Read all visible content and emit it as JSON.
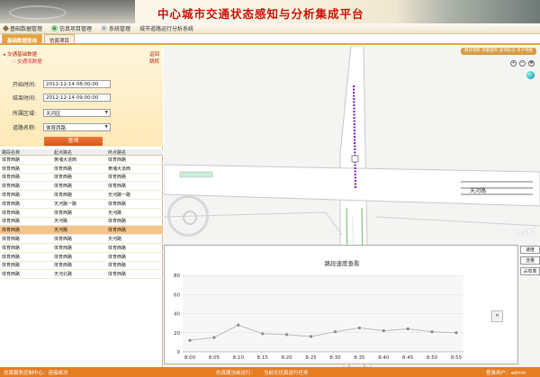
{
  "app": {
    "title": "中心城市交通状态感知与分析集成平台"
  },
  "menu": {
    "items": [
      {
        "label": "基础数据管理",
        "icon": "wrench-icon"
      },
      {
        "label": "仿真项目管理",
        "icon": "gear-icon"
      },
      {
        "label": "系统管理",
        "icon": "gear-icon"
      },
      {
        "label": "城市道路运行分析系统",
        "icon": ""
      }
    ]
  },
  "tabs": [
    {
      "label": "基础数据查询",
      "active": true
    },
    {
      "label": "仿真项目",
      "active": false
    }
  ],
  "left_panel": {
    "section_title": "交通基础数据",
    "back_link": "返回",
    "sub_title": "交通流数据",
    "jump_link": "跳转",
    "start_label": "开始时间:",
    "start_value": "2012-12-14 08:00:00",
    "end_label": "结束时间:",
    "end_value": "2012-12-14 09:00:00",
    "district_label": "所属区域:",
    "district_value": "天河区",
    "road_label": "道路名称:",
    "road_value": "体育西路",
    "query_button": "查询"
  },
  "table": {
    "headers": [
      "路段名称",
      "起点路名",
      "终点路名"
    ],
    "selected_index": 8,
    "rows": [
      [
        "体育西路",
        "黄埔大道西",
        "体育西路"
      ],
      [
        "体育西路",
        "体育西路",
        "黄埔大道西"
      ],
      [
        "体育西路",
        "体育西路",
        "体育西路"
      ],
      [
        "体育西路",
        "体育西路",
        "体育西路"
      ],
      [
        "体育西路",
        "体育西路",
        "天河路一路"
      ],
      [
        "体育西路",
        "天河路一路",
        "体育西路"
      ],
      [
        "体育西路",
        "体育西路",
        "天河路"
      ],
      [
        "体育西路",
        "天河路",
        "体育西路"
      ],
      [
        "体育西路",
        "天河路",
        "体育西路"
      ],
      [
        "体育西路",
        "体育西路",
        "天河路"
      ],
      [
        "体育西路",
        "体育西路",
        "体育西路"
      ],
      [
        "体育西路",
        "体育西路",
        "体育西路"
      ],
      [
        "体育西路",
        "体育西路",
        "体育西路"
      ],
      [
        "体育西路",
        "天河北路",
        "体育西路"
      ]
    ]
  },
  "map": {
    "toolbar_text": "测试测距  测量面积  查询标注  电子地图",
    "road_label": "天河路",
    "esri_logo": "esri",
    "side_buttons": [
      "速度",
      "流量",
      "占有率"
    ]
  },
  "chart_popup": {
    "close_label": "×"
  },
  "chart_data": {
    "type": "line",
    "title": "路段速度查看",
    "categories": [
      "8:00",
      "8:05",
      "8:10",
      "8:15",
      "8:20",
      "8:25",
      "8:30",
      "8:35",
      "8:40",
      "8:45",
      "8:50",
      "8:55"
    ],
    "values": [
      12,
      15,
      28,
      19,
      18,
      16,
      21,
      25,
      22,
      24,
      21,
      20
    ],
    "ylim": [
      0,
      80
    ],
    "yticks": [
      0,
      20,
      40,
      60,
      80
    ],
    "xlabel": "",
    "ylabel": "",
    "grid": true,
    "colors": {
      "line": "#b9b9b9",
      "point": "#8a8a8a"
    }
  },
  "status": {
    "left": "仿真服务控制中心：连接成功",
    "center1": "仿真器当前运行：",
    "center2": "当前无仿真运行任务",
    "right": "登录用户：admin"
  }
}
